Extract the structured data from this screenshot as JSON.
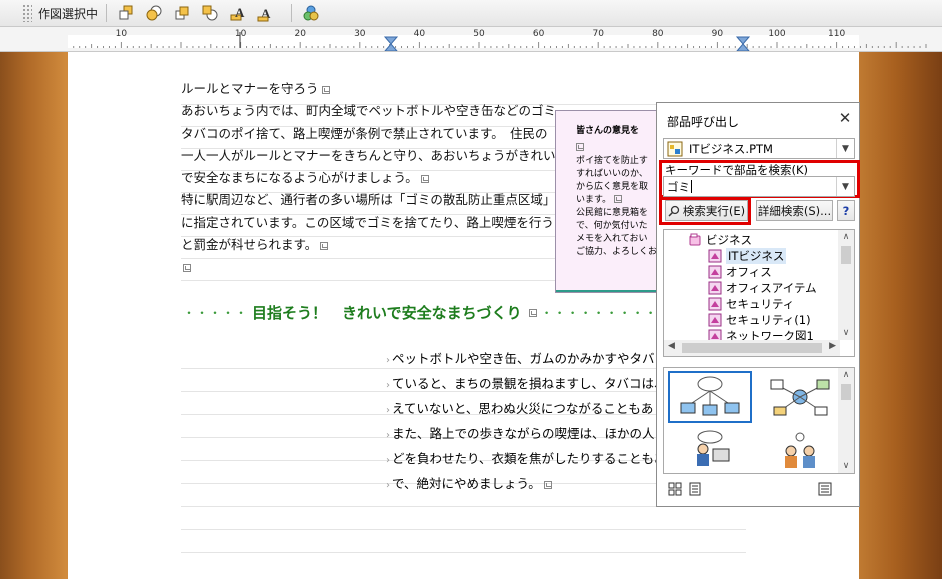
{
  "toolbar": {
    "mode_label": "作図選択中",
    "buttons": [
      "shape-front-icon",
      "shape-back-icon",
      "shape-front-one-icon",
      "shape-back-one-icon",
      "text-front-icon",
      "text-back-icon",
      "parts-group-icon"
    ]
  },
  "ruler": {
    "left_labels": [
      "10"
    ],
    "labels": [
      "10",
      "20",
      "30",
      "40",
      "50",
      "60",
      "70",
      "80",
      "90",
      "100",
      "110"
    ]
  },
  "document": {
    "para1": [
      "ルールとマナーを守ろう",
      "あおいちょう内では、町内全域でペットボトルや空き缶などのゴミ、",
      "タバコのポイ捨て、路上喫煙が条例で禁止されています。　住民の",
      "一人一人がルールとマナーをきちんと守り、あおいちょうがきれい",
      "で安全なまちになるよう心がけましょう。",
      "特に駅周辺など、通行者の多い場所は「ゴミの散乱防止重点区域」",
      "に指定されています。この区域でゴミを捨てたり、路上喫煙を行う",
      "と罰金が科せられます。"
    ],
    "heading_dots_left": "・・・・・",
    "heading": "目指そう！　きれいで安全なまちづくり",
    "heading_dots_right": "・・・・・・・・・・・",
    "para2": [
      "ペットボトルや空き缶、ガムのかみかすやタバコ",
      "ていると、まちの景観を損ねますし、タバコは、",
      "えていないと、思わぬ火災につながることもありま",
      "また、路上での歩きながらの喫煙は、ほかの人に",
      "どを負わせたり、衣類を焦がしたりすることもあ",
      "で、絶対にやめましょう。"
    ]
  },
  "notice": {
    "title": "皆さんの意見を",
    "lines": [
      "ポイ捨てを防止す",
      "すればいいのか、",
      "から広く意見を取",
      "います。",
      "公民館に意見箱を",
      "で、何か気付いた",
      "メモを入れておい",
      "ご協力、よろしくお"
    ]
  },
  "dialog": {
    "title": "部品呼び出し",
    "file_select": "ITビジネス.PTM",
    "search_label": "キーワードで部品を検索(K)",
    "search_value": "ゴミ",
    "search_button": "検索実行(E)",
    "detail_button": "詳細検索(S)...",
    "help_button": "?",
    "tree_root": "ビジネス",
    "tree_items": [
      "ITビジネス",
      "オフィス",
      "オフィスアイテム",
      "セキュリティ",
      "セキュリティ(1)",
      "ネットワーク図1"
    ],
    "accent_color": "#e00000",
    "selection_color": "#1f6fc8"
  }
}
